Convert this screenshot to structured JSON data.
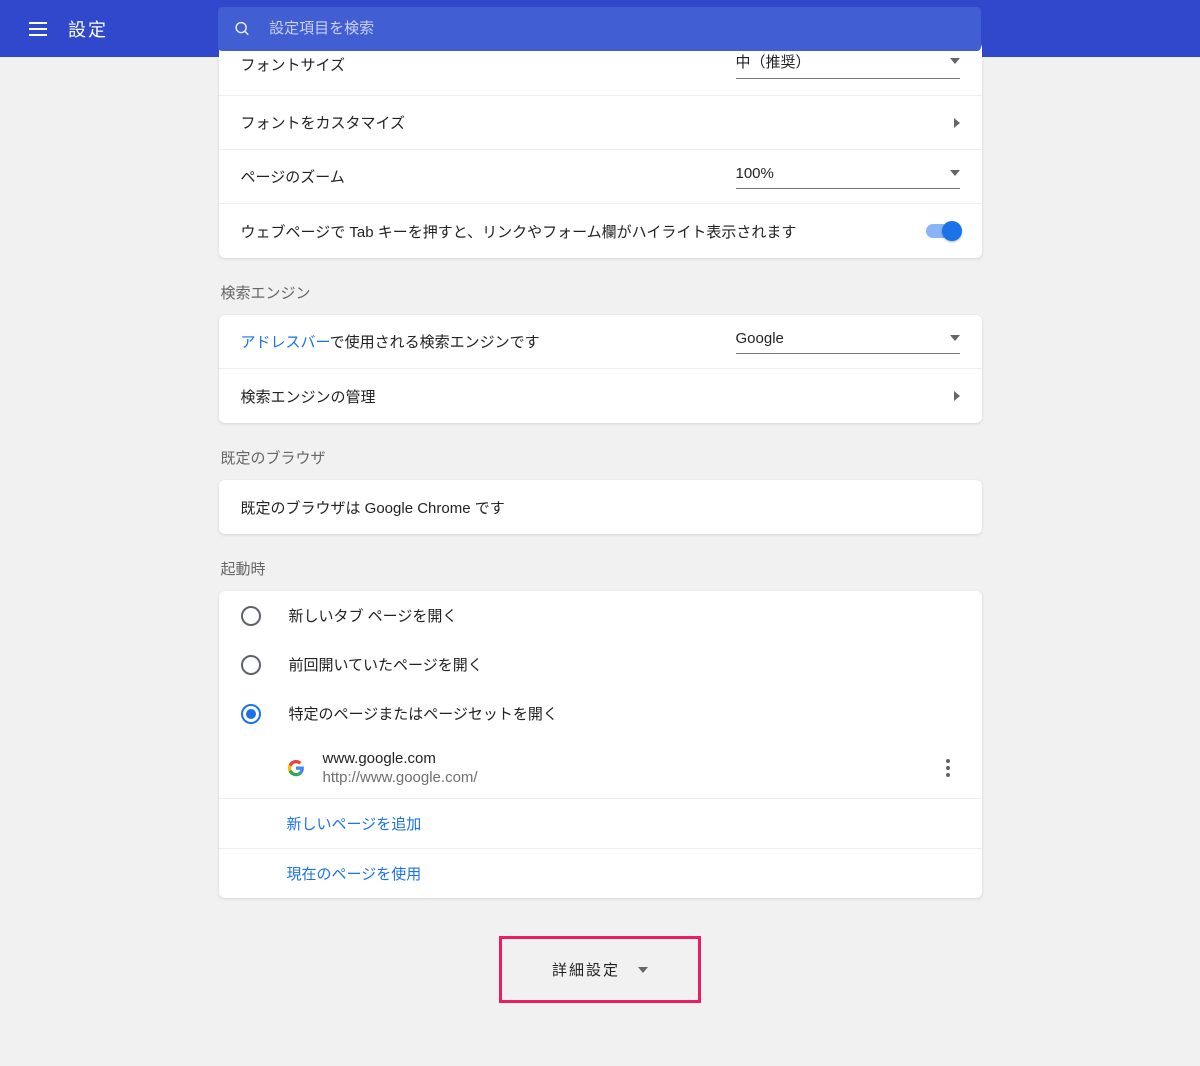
{
  "header": {
    "title": "設定",
    "search_placeholder": "設定項目を検索"
  },
  "appearance": {
    "font_size_label": "フォントサイズ",
    "font_size_value": "中（推奨）",
    "customize_fonts_label": "フォントをカスタマイズ",
    "page_zoom_label": "ページのズーム",
    "page_zoom_value": "100%",
    "tab_key_label": "ウェブページで Tab キーを押すと、リンクやフォーム欄がハイライト表示されます"
  },
  "search_engine": {
    "section_title": "検索エンジン",
    "address_bar_link": "アドレスバー",
    "address_bar_suffix": "で使用される検索エンジンです",
    "engine_value": "Google",
    "manage_label": "検索エンジンの管理"
  },
  "default_browser": {
    "section_title": "既定のブラウザ",
    "status_text": "既定のブラウザは Google Chrome です"
  },
  "startup": {
    "section_title": "起動時",
    "options": [
      "新しいタブ ページを開く",
      "前回開いていたページを開く",
      "特定のページまたはページセットを開く"
    ],
    "page_title": "www.google.com",
    "page_url": "http://www.google.com/",
    "add_page_label": "新しいページを追加",
    "use_current_label": "現在のページを使用"
  },
  "advanced_label": "詳細設定"
}
